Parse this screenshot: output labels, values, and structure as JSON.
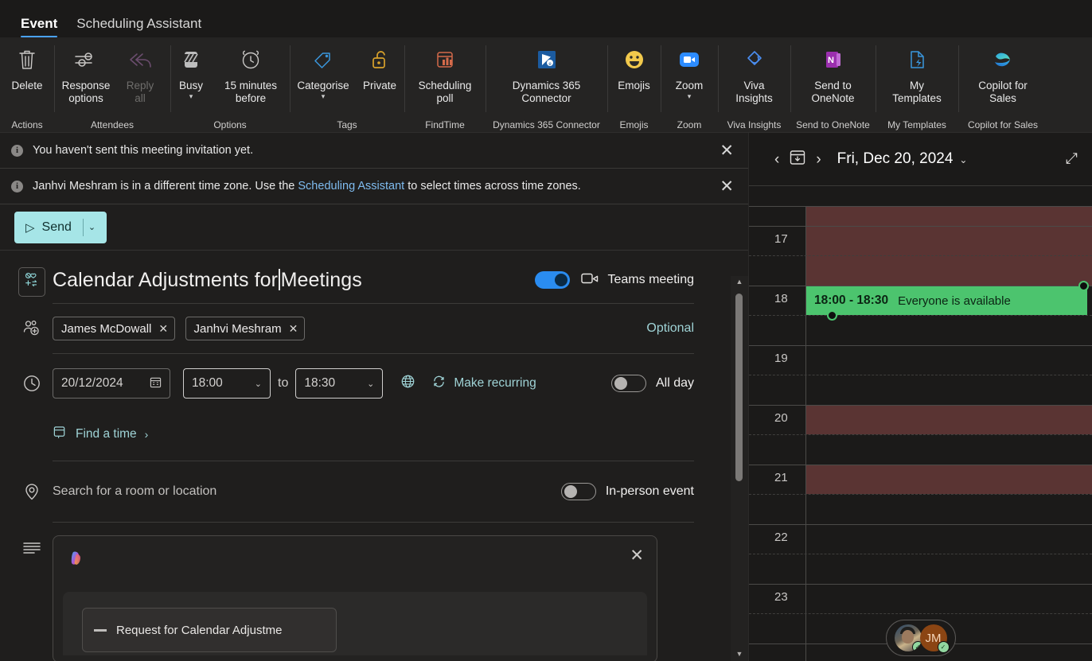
{
  "tabs": [
    {
      "label": "Event",
      "active": true
    },
    {
      "label": "Scheduling Assistant",
      "active": false
    }
  ],
  "ribbon": {
    "groups": [
      {
        "name": "Actions",
        "buttons": [
          {
            "label": "Delete",
            "icon": "delete-trash-icon",
            "chevron": false,
            "disabled": false
          }
        ]
      },
      {
        "name": "Attendees",
        "buttons": [
          {
            "label": "Response\noptions",
            "icon": "sliders-icon",
            "chevron": true,
            "disabled": false
          },
          {
            "label": "Reply\nall",
            "icon": "reply-all-icon",
            "chevron": false,
            "disabled": true
          }
        ]
      },
      {
        "name": "Options",
        "buttons": [
          {
            "label": "Busy",
            "icon": "busy-status-icon",
            "chevron": true,
            "disabled": false
          },
          {
            "label": "15 minutes\nbefore",
            "icon": "alarm-clock-icon",
            "chevron": true,
            "disabled": false
          }
        ]
      },
      {
        "name": "Tags",
        "buttons": [
          {
            "label": "Categorise",
            "icon": "tag-icon",
            "chevron": true,
            "disabled": false
          },
          {
            "label": "Private",
            "icon": "padlock-open-icon",
            "chevron": false,
            "disabled": false
          }
        ]
      },
      {
        "name": "FindTime",
        "buttons": [
          {
            "label": "Scheduling\npoll",
            "icon": "scheduling-poll-icon",
            "chevron": false,
            "disabled": false
          }
        ]
      },
      {
        "name": "Dynamics 365 Connector",
        "buttons": [
          {
            "label": "Dynamics 365\nConnector",
            "icon": "dynamics-365-icon",
            "chevron": false,
            "disabled": false
          }
        ]
      },
      {
        "name": "Emojis",
        "buttons": [
          {
            "label": "Emojis",
            "icon": "smiley-face-icon",
            "chevron": false,
            "disabled": false
          }
        ]
      },
      {
        "name": "Zoom",
        "buttons": [
          {
            "label": "Zoom",
            "icon": "zoom-camera-icon",
            "chevron": true,
            "disabled": false
          }
        ]
      },
      {
        "name": "Viva Insights",
        "buttons": [
          {
            "label": "Viva\nInsights",
            "icon": "viva-insights-icon",
            "chevron": false,
            "disabled": false
          }
        ]
      },
      {
        "name": "Send to OneNote",
        "buttons": [
          {
            "label": "Send to\nOneNote",
            "icon": "onenote-icon",
            "chevron": false,
            "disabled": false
          }
        ]
      },
      {
        "name": "My Templates",
        "buttons": [
          {
            "label": "My\nTemplates",
            "icon": "my-templates-icon",
            "chevron": false,
            "disabled": false
          }
        ]
      },
      {
        "name": "Copilot for Sales",
        "buttons": [
          {
            "label": "Copilot for\nSales",
            "icon": "copilot-icon",
            "chevron": false,
            "disabled": false
          }
        ]
      }
    ]
  },
  "notifications": [
    {
      "text": "You haven't sent this meeting invitation yet.",
      "link": "",
      "text_after": ""
    },
    {
      "text": "Janhvi Meshram is in a different time zone. Use the ",
      "link": "Scheduling Assistant",
      "text_after": " to select times across time zones."
    }
  ],
  "send": {
    "label": "Send"
  },
  "event": {
    "title_before_caret": "Calendar Adjustments for",
    "title_after_caret": "Meetings",
    "teams_meeting_label": "Teams meeting",
    "teams_meeting_on": true,
    "attendees": [
      {
        "name": "James McDowall"
      },
      {
        "name": "Janhvi Meshram"
      }
    ],
    "optional_label": "Optional",
    "date": "20/12/2024",
    "start_time": "18:00",
    "to_label": "to",
    "end_time": "18:30",
    "make_recurring_label": "Make recurring",
    "all_day_label": "All day",
    "all_day_on": false,
    "find_a_time_label": "Find a time",
    "location_placeholder": "Search for a room or location",
    "in_person_label": "In-person event",
    "in_person_on": false,
    "copilot_suggestion": "Request for Calendar Adjustme"
  },
  "calendar": {
    "date_label": "Fri, Dec 20, 2024",
    "hours": [
      "17",
      "18",
      "19",
      "20",
      "21",
      "22",
      "23"
    ],
    "free_block": {
      "time_range": "18:00 - 18:30",
      "status": "Everyone is available"
    },
    "busy_blocks": [
      {
        "label": "busy-16-18"
      },
      {
        "label": "busy-20"
      },
      {
        "label": "busy-21"
      }
    ],
    "attendee_pills": [
      {
        "type": "photo",
        "initials": ""
      },
      {
        "type": "initials",
        "initials": "JM"
      }
    ]
  },
  "colors": {
    "accent_blue": "#2a8cf0",
    "send_button": "#a6e5e7",
    "free_green": "#4cc46e",
    "busy_maroon": "#5a3433",
    "link_teal": "#9fd3d6"
  }
}
